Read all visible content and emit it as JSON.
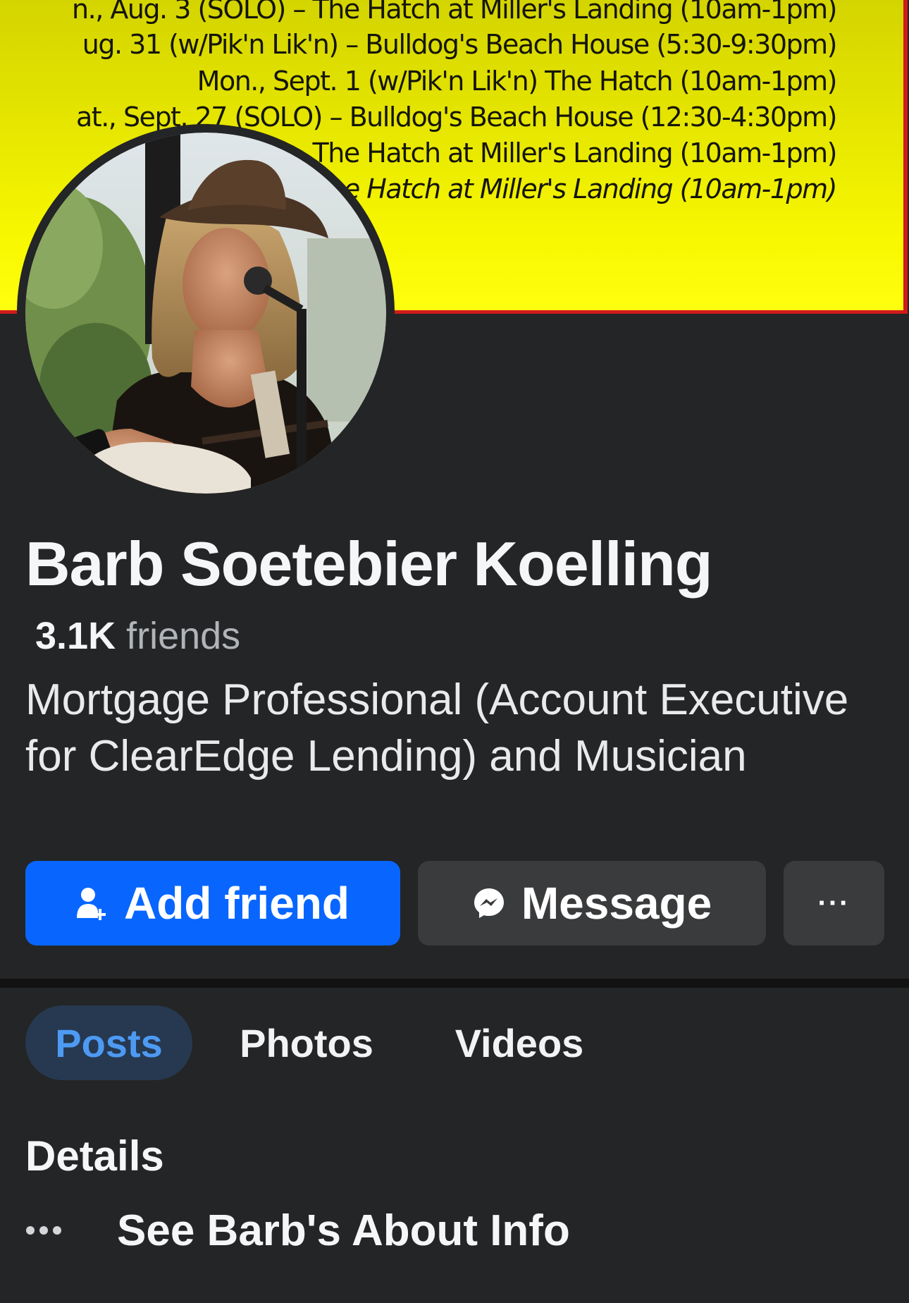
{
  "cover": {
    "schedule": [
      "n., Aug. 3 (SOLO) – The Hatch at Miller's Landing (10am-1pm)",
      "ug. 31 (w/Pik'n Lik'n) – Bulldog's Beach House (5:30-9:30pm)",
      "Mon., Sept. 1 (w/Pik'n Lik'n) The Hatch (10am-1pm)",
      "at., Sept. 27 (SOLO) – Bulldog's Beach House (12:30-4:30pm)",
      "Sept. 28 – The Hatch at Miller's Landing (10am-1pm)",
      "., Oct. – The Hatch at Miller's Landing (10am-1pm)"
    ]
  },
  "profile": {
    "name": "Barb Soetebier Koelling",
    "friend_count": "3.1K",
    "friends_label": "friends",
    "bio": "Mortgage Professional (Account Executive for ClearEdge Lending) and Musician"
  },
  "actions": {
    "add_friend": "Add friend",
    "message": "Message",
    "more": "···"
  },
  "tabs": [
    {
      "label": "Posts",
      "active": true
    },
    {
      "label": "Photos",
      "active": false
    },
    {
      "label": "Videos",
      "active": false
    }
  ],
  "details": {
    "title": "Details",
    "about_link": "See Barb's About Info"
  },
  "colors": {
    "background": "#242526",
    "primary_button": "#0866ff",
    "secondary_button": "#3a3b3c",
    "active_tab_bg": "#263951",
    "active_tab_text": "#4d9af3",
    "cover_yellow": "#ffff10",
    "cover_border": "#d11b1b"
  },
  "icons": {
    "add_friend": "person-plus-icon",
    "message": "messenger-icon",
    "more": "more-horizontal-icon",
    "about": "more-horizontal-icon"
  }
}
